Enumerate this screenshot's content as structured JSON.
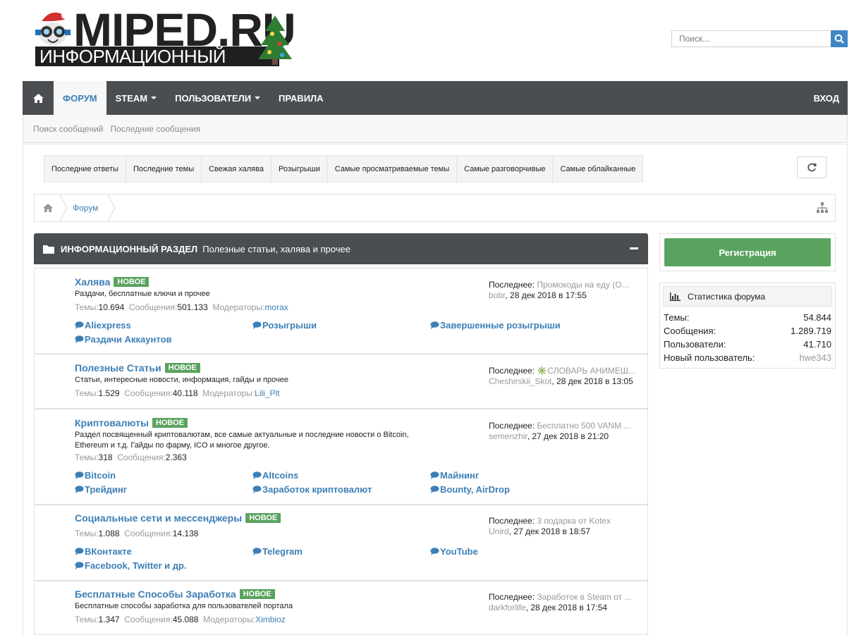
{
  "logo": {
    "main": "MIPED.RU",
    "sub": "ИНФОРМАЦИОННЫЙ ПОРТАЛ"
  },
  "search": {
    "placeholder": "Поиск..."
  },
  "nav": {
    "items": [
      {
        "label": "Форум",
        "active": true
      },
      {
        "label": "Steam",
        "dropdown": true
      },
      {
        "label": "Пользователи",
        "dropdown": true
      },
      {
        "label": "Правила"
      }
    ],
    "login": "Вход"
  },
  "subnav": [
    "Поиск сообщений",
    "Последние сообщения"
  ],
  "tabs": [
    "Последние ответы",
    "Последние темы",
    "Свежая халява",
    "Розыгрыши",
    "Самые просматриваемые темы",
    "Самые разговорчивые",
    "Самые облайканные"
  ],
  "breadcrumb": {
    "label": "Форум"
  },
  "section": {
    "title": "ИНФОРМАЦИОННЫЙ РАЗДЕЛ",
    "desc": "Полезные статьи, халява и прочее"
  },
  "labels": {
    "threads": "Темы:",
    "posts": "Сообщения:",
    "moderators": "Модераторы:",
    "last": "Последнее: ",
    "new_badge": "НОВОЕ"
  },
  "forums": [
    {
      "title": "Халява",
      "desc": "Раздачи, бесплатные ключи и прочее",
      "threads": "10.694",
      "posts": "501.133",
      "moderator": "morax",
      "last_title": "Промокоды на еду (О...",
      "last_user": "bobr",
      "last_date": ", 28 дек 2018 в 17:55",
      "subs": [
        "Aliexpress",
        "Розыгрыши",
        "Завершенные розыгрыши",
        "Раздачи Аккаунтов"
      ]
    },
    {
      "title": "Полезные Статьи",
      "desc": "Статьи, интересные новости, информация, гайды и прочее",
      "threads": "1.529",
      "posts": "40.118",
      "moderator": "Lili_Plt",
      "last_title": "✳️СЛОВАРЬ АНИМЕШ...",
      "last_user": "Cheshirskii_Skot",
      "last_date": ", 28 дек 2018 в 13:05",
      "subs": []
    },
    {
      "title": "Криптовалюты",
      "desc": "Раздел посвященный криптовалютам, все самые актуальные и последние новости о Bitcoin, Ethereum и т.д. Гайды по фарму, ICO и многое другое.",
      "threads": "318",
      "posts": "2.363",
      "moderator": "",
      "last_title": "Бесплатно 500 VANM ...",
      "last_user": "semenzhir",
      "last_date": ", 27 дек 2018 в 21:20",
      "subs": [
        "Bitcoin",
        "Altcoins",
        "Майнинг",
        "Трейдинг",
        "Заработок криптовалют",
        "Bounty, AirDrop"
      ]
    },
    {
      "title": "Социальные сети и мессенджеры",
      "desc": "",
      "threads": "1.088",
      "posts": "14.138",
      "moderator": "",
      "last_title": "3 подарка от Kotex",
      "last_user": "Unird",
      "last_date": ", 27 дек 2018 в 18:57",
      "subs": [
        "ВКонтакте",
        "Telegram",
        "YouTube",
        "Facebook, Twitter и др."
      ]
    },
    {
      "title": "Бесплатные Способы Заработка",
      "desc": "Бесплатные способы заработка для пользователей портала",
      "threads": "1.347",
      "posts": "45.088",
      "moderator": "Ximbioz",
      "last_title": "Заработок в Steam от ...",
      "last_user": "darkforlife",
      "last_date": ", 28 дек 2018 в 17:54",
      "subs": []
    }
  ],
  "sidebar": {
    "register": "Регистрация",
    "stats_title": "Статистика форума",
    "stats": [
      {
        "label": "Темы:",
        "value": "54.844"
      },
      {
        "label": "Сообщения:",
        "value": "1.289.719"
      },
      {
        "label": "Пользователи:",
        "value": "41.710"
      },
      {
        "label": "Новый пользователь:",
        "value": "hwe343"
      }
    ]
  },
  "colors": {
    "accent": "#3c7fb6",
    "nav": "#4b4e51",
    "new_badge": "#5aa35f"
  }
}
